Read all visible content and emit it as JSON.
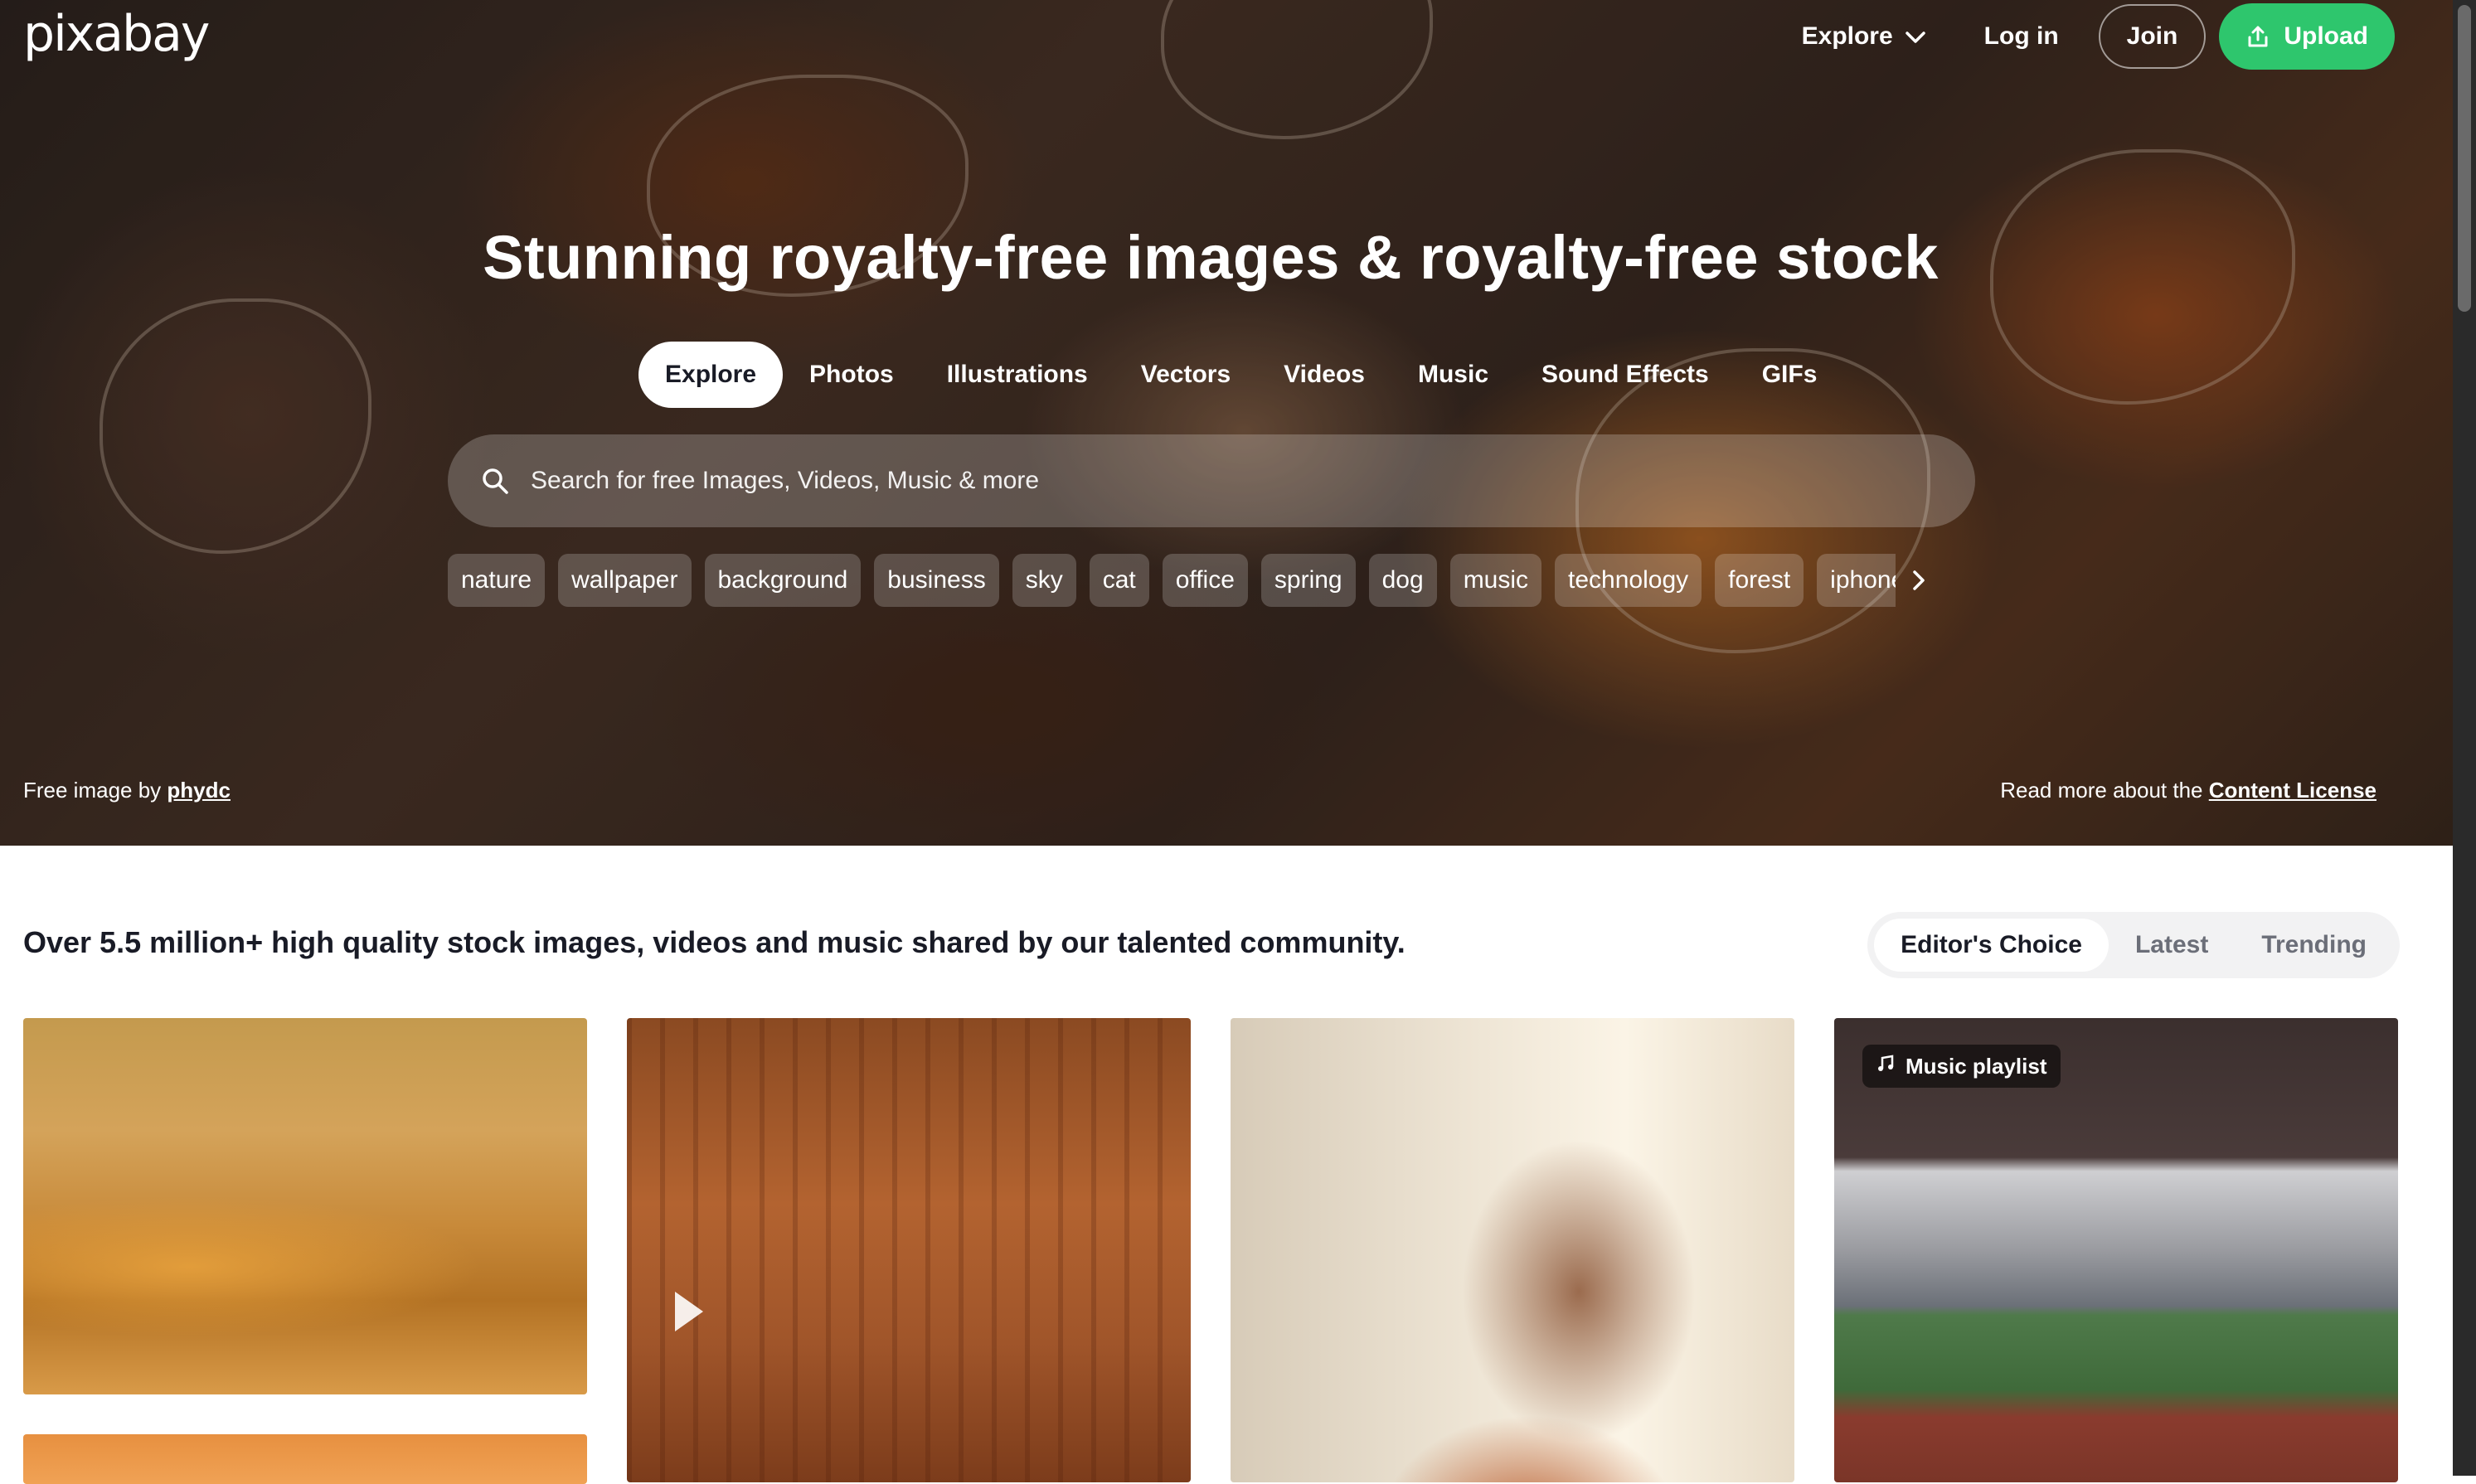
{
  "header": {
    "logo": "pixabay",
    "explore_label": "Explore",
    "login_label": "Log in",
    "join_label": "Join",
    "upload_label": "Upload"
  },
  "hero": {
    "title": "Stunning royalty-free images & royalty-free stock",
    "tabs": [
      {
        "label": "Explore",
        "active": true
      },
      {
        "label": "Photos"
      },
      {
        "label": "Illustrations"
      },
      {
        "label": "Vectors"
      },
      {
        "label": "Videos"
      },
      {
        "label": "Music"
      },
      {
        "label": "Sound Effects"
      },
      {
        "label": "GIFs"
      }
    ],
    "search_placeholder": "Search for free Images, Videos, Music & more",
    "tags": [
      "nature",
      "wallpaper",
      "background",
      "business",
      "sky",
      "cat",
      "office",
      "spring",
      "dog",
      "music",
      "technology",
      "forest",
      "iphone"
    ],
    "credit_prefix": "Free image by",
    "credit_author": "phydc",
    "license_prefix": "Read more about the",
    "license_link": "Content License"
  },
  "main": {
    "tagline": "Over 5.5 million+ high quality stock images, videos and music shared by our talented community.",
    "sort_options": [
      {
        "label": "Editor's Choice",
        "active": true
      },
      {
        "label": "Latest"
      },
      {
        "label": "Trending"
      }
    ],
    "cards": [
      {
        "badge": ""
      },
      {
        "badge": ""
      },
      {
        "badge": ""
      },
      {
        "badge": "Music playlist"
      }
    ]
  },
  "colors": {
    "accent": "#2ec66d",
    "text": "#191b26"
  }
}
